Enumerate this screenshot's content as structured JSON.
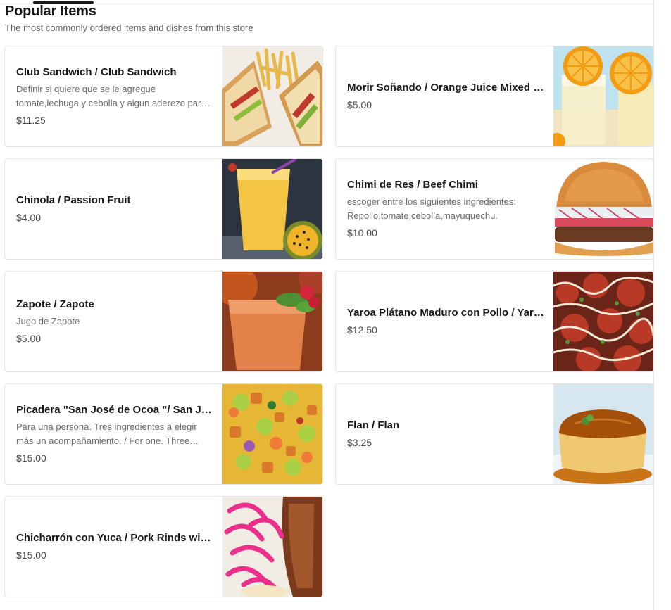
{
  "section": {
    "title": "Popular Items",
    "subtitle": "The most commonly ordered items and dishes from this store"
  },
  "items": [
    {
      "name": "Club Sandwich / Club Sandwich",
      "description": "Definir si quiere que se le agregue tomate,lechuga y cebolla y algun aderezo para acompañar.",
      "price": "$11.25",
      "image": "club-sandwich-photo"
    },
    {
      "name": "Morir Soñando / Orange Juice Mixed with Milk",
      "description": "",
      "price": "$5.00",
      "image": "orange-juice-photo"
    },
    {
      "name": "Chinola / Passion Fruit",
      "description": "",
      "price": "$4.00",
      "image": "passion-fruit-juice-photo"
    },
    {
      "name": "Chimi de Res / Beef Chimi",
      "description": "escoger entre los siguientes ingredientes: Repollo,tomate,cebolla,mayuquechu.",
      "price": "$10.00",
      "image": "beef-chimi-photo"
    },
    {
      "name": "Zapote / Zapote",
      "description": "Jugo de Zapote",
      "price": "$5.00",
      "image": "zapote-smoothie-photo"
    },
    {
      "name": "Yaroa Plátano Maduro con Pollo / Yaroa Sweet Plantain with Chicken",
      "description": "",
      "price": "$12.50",
      "image": "yaroa-photo"
    },
    {
      "name": "Picadera \"San José de Ocoa \"/ San José de Ocoa Platter",
      "description": "Para una persona. Tres ingredientes a elegir más un acompañamiento. / For one. Three ingredients of your choice plus a side.",
      "price": "$15.00",
      "image": "picadera-platter-photo"
    },
    {
      "name": "Flan / Flan",
      "description": "",
      "price": "$3.25",
      "image": "flan-photo"
    },
    {
      "name": "Chicharrón con Yuca / Pork Rinds with Yuca",
      "description": "",
      "price": "$15.00",
      "image": "chicharron-photo"
    }
  ],
  "colors": {
    "title": "#191919",
    "subtitle": "#606060",
    "description": "#6b6b6b",
    "price": "#494949",
    "card_border": "#e4e4e4"
  }
}
